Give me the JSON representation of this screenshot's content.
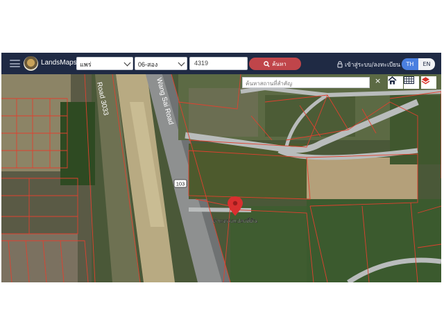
{
  "header": {
    "brand": "LandsMaps",
    "province_select": "แพร่",
    "district_select": "06-สอง",
    "parcel_number_input": "4319",
    "search_button_label": "ค้นหา",
    "login_label": "เข้าสู่ระบบ/ลงทะเบียน",
    "lang_th": "TH",
    "lang_en": "EN"
  },
  "map": {
    "place_search_placeholder": "ค้นหาสถานที่สำคัญ",
    "clear_symbol": "×",
    "road_labels": {
      "road_3033": "Road 3033",
      "wang_sai_road": "Wang Sai Road",
      "shield_103": "103"
    },
    "marker_label": "ตำแหน่งแปลงที่ดิน"
  },
  "colors": {
    "header_bg": "#1f2a44",
    "search_button": "#c0454a",
    "lang_active": "#4a7fe0",
    "parcel_lines": "#e0412f",
    "marker": "#d92f2f"
  },
  "icons": [
    "menu-icon",
    "logo-icon",
    "search-icon",
    "lock-icon",
    "home-icon",
    "grid-icon",
    "layers-icon",
    "map-pin-icon"
  ]
}
